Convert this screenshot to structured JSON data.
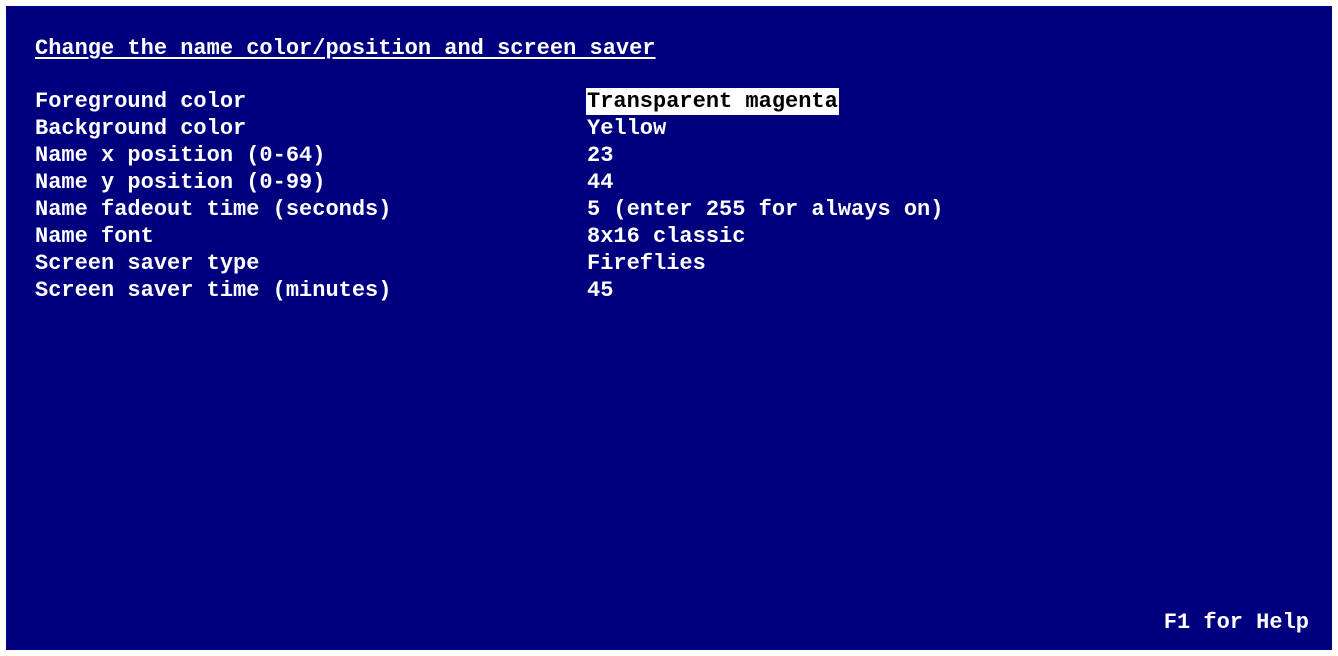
{
  "screen": {
    "title": "Change the name color/position and screen saver",
    "help_hint": "F1 for Help"
  },
  "settings": [
    {
      "label": "Foreground color",
      "value": "Transparent magenta",
      "selected": true
    },
    {
      "label": "Background color",
      "value": "Yellow",
      "selected": false
    },
    {
      "label": "Name x position (0-64)",
      "value": "23",
      "selected": false
    },
    {
      "label": "Name y position (0-99)",
      "value": "44",
      "selected": false
    },
    {
      "label": "Name fadeout time (seconds)",
      "value": "5 (enter 255 for always on)",
      "selected": false
    },
    {
      "label": "Name font",
      "value": "8x16 classic",
      "selected": false
    },
    {
      "label": "Screen saver type",
      "value": "Fireflies",
      "selected": false
    },
    {
      "label": "Screen saver time (minutes)",
      "value": "45",
      "selected": false
    }
  ],
  "colors": {
    "background": "#00007f",
    "text": "#ffffff",
    "selection_background": "#ffffff",
    "selection_text": "#000000"
  }
}
